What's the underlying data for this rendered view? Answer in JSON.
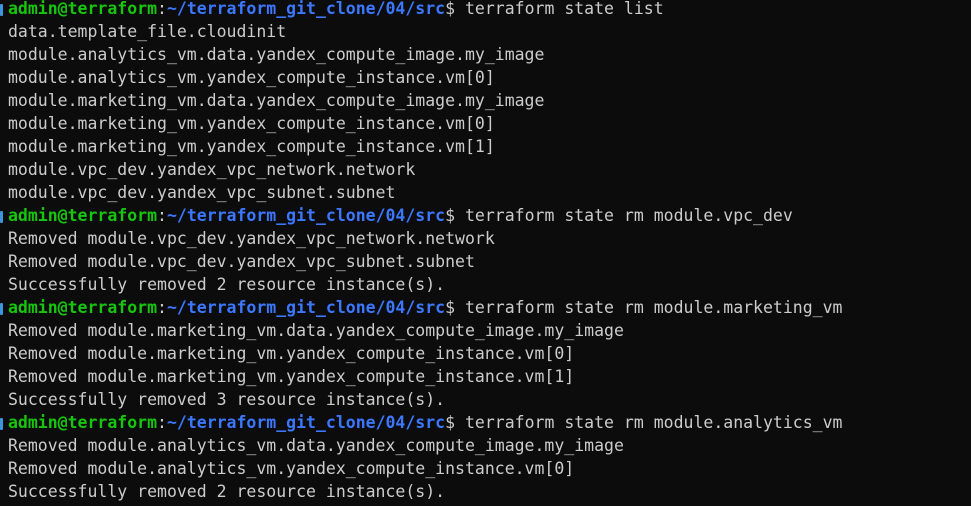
{
  "colors": {
    "background": "#0c0c0c",
    "text": "#cccccc",
    "user_host": "#16c60c",
    "path": "#3b78ff",
    "prompt_marker": "#3a96dd"
  },
  "lines": [
    {
      "type": "prompt",
      "user": "admin@terraform",
      "sep": ":",
      "path": "~/terraform_git_clone/04/src",
      "cmd": "$ terraform state list"
    },
    {
      "type": "output",
      "text": "data.template_file.cloudinit"
    },
    {
      "type": "output",
      "text": "module.analytics_vm.data.yandex_compute_image.my_image"
    },
    {
      "type": "output",
      "text": "module.analytics_vm.yandex_compute_instance.vm[0]"
    },
    {
      "type": "output",
      "text": "module.marketing_vm.data.yandex_compute_image.my_image"
    },
    {
      "type": "output",
      "text": "module.marketing_vm.yandex_compute_instance.vm[0]"
    },
    {
      "type": "output",
      "text": "module.marketing_vm.yandex_compute_instance.vm[1]"
    },
    {
      "type": "output",
      "text": "module.vpc_dev.yandex_vpc_network.network"
    },
    {
      "type": "output",
      "text": "module.vpc_dev.yandex_vpc_subnet.subnet"
    },
    {
      "type": "prompt",
      "user": "admin@terraform",
      "sep": ":",
      "path": "~/terraform_git_clone/04/src",
      "cmd": "$ terraform state rm module.vpc_dev"
    },
    {
      "type": "output",
      "text": "Removed module.vpc_dev.yandex_vpc_network.network"
    },
    {
      "type": "output",
      "text": "Removed module.vpc_dev.yandex_vpc_subnet.subnet"
    },
    {
      "type": "output",
      "text": "Successfully removed 2 resource instance(s)."
    },
    {
      "type": "prompt",
      "user": "admin@terraform",
      "sep": ":",
      "path": "~/terraform_git_clone/04/src",
      "cmd": "$ terraform state rm module.marketing_vm"
    },
    {
      "type": "output",
      "text": "Removed module.marketing_vm.data.yandex_compute_image.my_image"
    },
    {
      "type": "output",
      "text": "Removed module.marketing_vm.yandex_compute_instance.vm[0]"
    },
    {
      "type": "output",
      "text": "Removed module.marketing_vm.yandex_compute_instance.vm[1]"
    },
    {
      "type": "output",
      "text": "Successfully removed 3 resource instance(s)."
    },
    {
      "type": "prompt",
      "user": "admin@terraform",
      "sep": ":",
      "path": "~/terraform_git_clone/04/src",
      "cmd": "$ terraform state rm module.analytics_vm"
    },
    {
      "type": "output",
      "text": "Removed module.analytics_vm.data.yandex_compute_image.my_image"
    },
    {
      "type": "output",
      "text": "Removed module.analytics_vm.yandex_compute_instance.vm[0]"
    },
    {
      "type": "output",
      "text": "Successfully removed 2 resource instance(s)."
    }
  ]
}
